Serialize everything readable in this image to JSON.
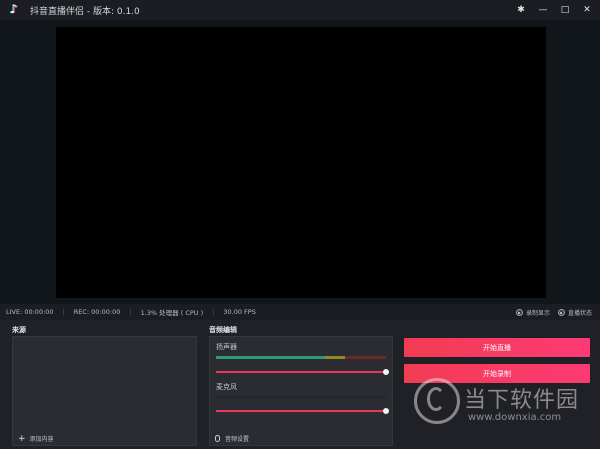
{
  "window": {
    "title": "抖音直播伴侣 - 版本: 0.1.0",
    "controls": {
      "settings": "✱",
      "minimize": "—",
      "maximize": "□",
      "close": "✕"
    }
  },
  "status": {
    "live": "LIVE: 00:00:00",
    "sep": "|",
    "rec": "REC: 00:00:00",
    "cpu": "1.3% 处理器 ( CPU )",
    "fps": "30.00 FPS",
    "options": [
      "录制显示",
      "直播状态"
    ]
  },
  "sources": {
    "title": "来源",
    "add_label": "添加内容",
    "add_icon": "+"
  },
  "audio": {
    "title": "音频编辑",
    "channels": [
      {
        "label": "扬声器",
        "level": 0.64,
        "volume": 1.0
      },
      {
        "label": "麦克风",
        "level": 0.0,
        "volume": 1.0
      }
    ],
    "settings_label": "音频设置"
  },
  "actions": {
    "start_live": "开始直播",
    "start_record": "开始录制"
  },
  "watermark": {
    "brand": "当下软件园",
    "url": "www.downxia.com"
  },
  "colors": {
    "accent_start": "#f23c53",
    "accent_end": "#fd3a74",
    "meter_green": "#2b9b73",
    "slider_red": "#e8395a"
  }
}
